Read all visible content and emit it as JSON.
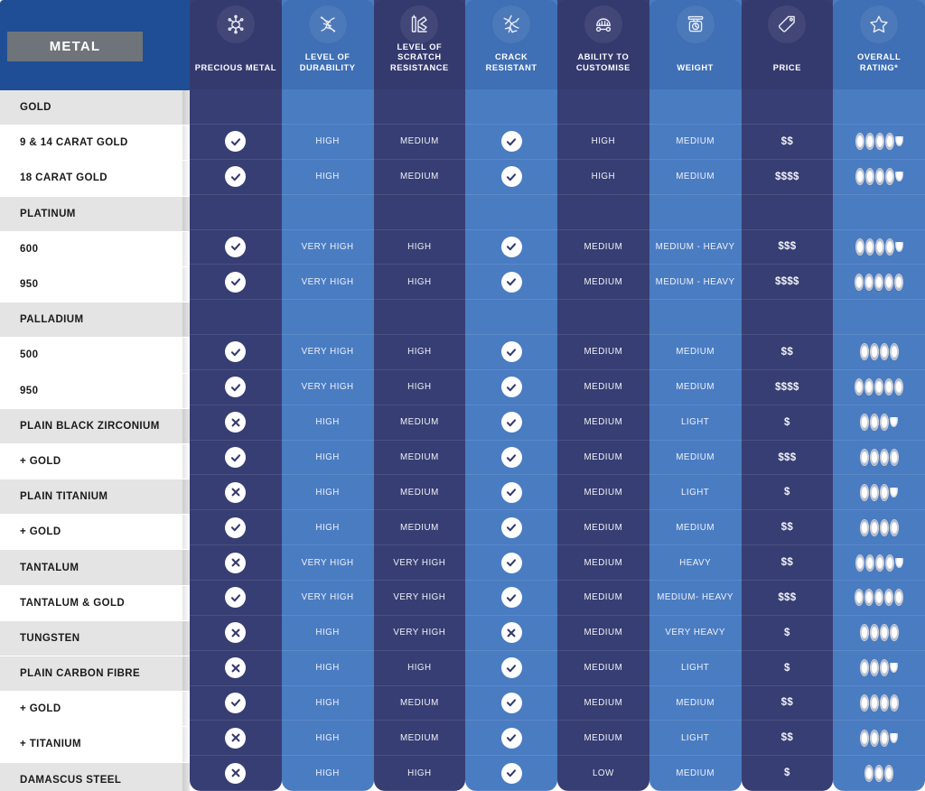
{
  "header": {
    "metal_label": "METAL",
    "columns": [
      {
        "label": "PRECIOUS METAL",
        "icon": "molecule-icon",
        "tone": "dark"
      },
      {
        "label": "LEVEL OF\nDURABILITY",
        "icon": "dna-helix-icon",
        "tone": "light"
      },
      {
        "label": "LEVEL OF\nSCRATCH\nRESISTANCE",
        "icon": "scratch-test-icon",
        "tone": "dark"
      },
      {
        "label": "CRACK\nRESISTANT",
        "icon": "crack-icon",
        "tone": "light"
      },
      {
        "label": "ABILITY TO\nCUSTOMISE",
        "icon": "ring-tools-icon",
        "tone": "dark"
      },
      {
        "label": "WEIGHT",
        "icon": "scale-icon",
        "tone": "light"
      },
      {
        "label": "PRICE",
        "icon": "price-tag-icon",
        "tone": "dark"
      },
      {
        "label": "OVERALL\nRATING*",
        "icon": "star-icon",
        "tone": "light"
      }
    ]
  },
  "colors": {
    "header_blue": "#1f4e96",
    "ribbon_gray": "#6e7479",
    "ribbon_gray_light": "#a6abb0",
    "column_dark": "#373e73",
    "column_light": "#4a7cc2",
    "row_gray": "#e4e4e4",
    "row_white": "#ffffff",
    "badge_fill": "#ffffff",
    "badge_mark": "#343a6e"
  },
  "rows": [
    {
      "name": "GOLD",
      "shade": "gray",
      "group": true,
      "precious": "",
      "durability": "",
      "scratch": "",
      "crack": "",
      "customise": "",
      "weight": "",
      "price": "",
      "rating": 0,
      "half": false
    },
    {
      "name": "9 & 14 CARAT GOLD",
      "shade": "white",
      "group": false,
      "precious": "check",
      "durability": "HIGH",
      "scratch": "MEDIUM",
      "crack": "check",
      "customise": "HIGH",
      "weight": "MEDIUM",
      "price": "$$",
      "rating": 4,
      "half": true
    },
    {
      "name": "18 CARAT GOLD",
      "shade": "white",
      "group": false,
      "precious": "check",
      "durability": "HIGH",
      "scratch": "MEDIUM",
      "crack": "check",
      "customise": "HIGH",
      "weight": "MEDIUM",
      "price": "$$$$",
      "rating": 4,
      "half": true
    },
    {
      "name": "PLATINUM",
      "shade": "gray",
      "group": true,
      "precious": "",
      "durability": "",
      "scratch": "",
      "crack": "",
      "customise": "",
      "weight": "",
      "price": "",
      "rating": 0,
      "half": false
    },
    {
      "name": "600",
      "shade": "white",
      "group": false,
      "precious": "check",
      "durability": "VERY HIGH",
      "scratch": "HIGH",
      "crack": "check",
      "customise": "MEDIUM",
      "weight": "MEDIUM - HEAVY",
      "price": "$$$",
      "rating": 4,
      "half": true
    },
    {
      "name": "950",
      "shade": "white",
      "group": false,
      "precious": "check",
      "durability": "VERY HIGH",
      "scratch": "HIGH",
      "crack": "check",
      "customise": "MEDIUM",
      "weight": "MEDIUM - HEAVY",
      "price": "$$$$",
      "rating": 5,
      "half": false
    },
    {
      "name": "PALLADIUM",
      "shade": "gray",
      "group": true,
      "precious": "",
      "durability": "",
      "scratch": "",
      "crack": "",
      "customise": "",
      "weight": "",
      "price": "",
      "rating": 0,
      "half": false
    },
    {
      "name": "500",
      "shade": "white",
      "group": false,
      "precious": "check",
      "durability": "VERY HIGH",
      "scratch": "HIGH",
      "crack": "check",
      "customise": "MEDIUM",
      "weight": "MEDIUM",
      "price": "$$",
      "rating": 4,
      "half": false
    },
    {
      "name": "950",
      "shade": "white",
      "group": false,
      "precious": "check",
      "durability": "VERY HIGH",
      "scratch": "HIGH",
      "crack": "check",
      "customise": "MEDIUM",
      "weight": "MEDIUM",
      "price": "$$$$",
      "rating": 5,
      "half": false
    },
    {
      "name": "PLAIN BLACK ZIRCONIUM",
      "shade": "gray",
      "group": false,
      "precious": "cross",
      "durability": "HIGH",
      "scratch": "MEDIUM",
      "crack": "check",
      "customise": "MEDIUM",
      "weight": "LIGHT",
      "price": "$",
      "rating": 3,
      "half": true
    },
    {
      "name": "+ GOLD",
      "shade": "white",
      "group": false,
      "precious": "check",
      "durability": "HIGH",
      "scratch": "MEDIUM",
      "crack": "check",
      "customise": "MEDIUM",
      "weight": "MEDIUM",
      "price": "$$$",
      "rating": 4,
      "half": false
    },
    {
      "name": "PLAIN TITANIUM",
      "shade": "gray",
      "group": false,
      "precious": "cross",
      "durability": "HIGH",
      "scratch": "MEDIUM",
      "crack": "check",
      "customise": "MEDIUM",
      "weight": "LIGHT",
      "price": "$",
      "rating": 3,
      "half": true
    },
    {
      "name": "+ GOLD",
      "shade": "white",
      "group": false,
      "precious": "check",
      "durability": "HIGH",
      "scratch": "MEDIUM",
      "crack": "check",
      "customise": "MEDIUM",
      "weight": "MEDIUM",
      "price": "$$",
      "rating": 4,
      "half": false
    },
    {
      "name": "TANTALUM",
      "shade": "gray",
      "group": false,
      "precious": "cross",
      "durability": "VERY HIGH",
      "scratch": "VERY HIGH",
      "crack": "check",
      "customise": "MEDIUM",
      "weight": "HEAVY",
      "price": "$$",
      "rating": 4,
      "half": true
    },
    {
      "name": "TANTALUM & GOLD",
      "shade": "white",
      "group": false,
      "precious": "check",
      "durability": "VERY HIGH",
      "scratch": "VERY HIGH",
      "crack": "check",
      "customise": "MEDIUM",
      "weight": "MEDIUM- HEAVY",
      "price": "$$$",
      "rating": 5,
      "half": false
    },
    {
      "name": "TUNGSTEN",
      "shade": "gray",
      "group": false,
      "precious": "cross",
      "durability": "HIGH",
      "scratch": "VERY HIGH",
      "crack": "cross",
      "customise": "MEDIUM",
      "weight": "VERY HEAVY",
      "price": "$",
      "rating": 4,
      "half": false
    },
    {
      "name": "PLAIN CARBON FIBRE",
      "shade": "gray",
      "group": false,
      "precious": "cross",
      "durability": "HIGH",
      "scratch": "HIGH",
      "crack": "check",
      "customise": "MEDIUM",
      "weight": "LIGHT",
      "price": "$",
      "rating": 3,
      "half": true
    },
    {
      "name": "+ GOLD",
      "shade": "white",
      "group": false,
      "precious": "check",
      "durability": "HIGH",
      "scratch": "MEDIUM",
      "crack": "check",
      "customise": "MEDIUM",
      "weight": "MEDIUM",
      "price": "$$",
      "rating": 4,
      "half": false
    },
    {
      "name": "+ TITANIUM",
      "shade": "white",
      "group": false,
      "precious": "cross",
      "durability": "HIGH",
      "scratch": "MEDIUM",
      "crack": "check",
      "customise": "MEDIUM",
      "weight": "LIGHT",
      "price": "$$",
      "rating": 3,
      "half": true
    },
    {
      "name": "DAMASCUS STEEL",
      "shade": "gray",
      "group": false,
      "precious": "cross",
      "durability": "HIGH",
      "scratch": "HIGH",
      "crack": "check",
      "customise": "LOW",
      "weight": "MEDIUM",
      "price": "$",
      "rating": 3,
      "half": false
    }
  ]
}
